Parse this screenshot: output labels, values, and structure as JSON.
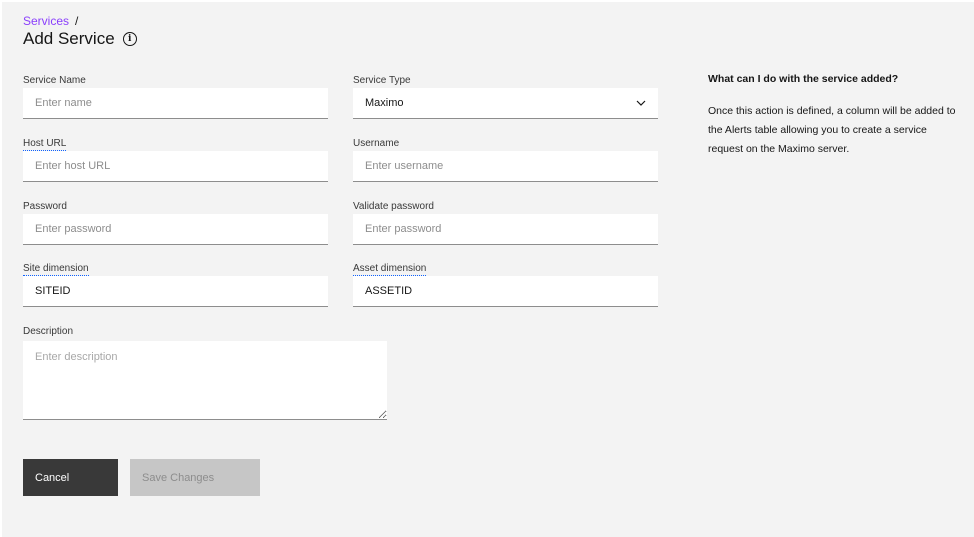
{
  "breadcrumb": {
    "parent": "Services",
    "separator": "/"
  },
  "page": {
    "title": "Add Service",
    "info_icon": "info-icon"
  },
  "form": {
    "service_name": {
      "label": "Service Name",
      "placeholder": "Enter name",
      "value": ""
    },
    "service_type": {
      "label": "Service Type",
      "value": "Maximo"
    },
    "host_url": {
      "label": "Host URL",
      "placeholder": "Enter host URL",
      "value": ""
    },
    "username": {
      "label": "Username",
      "placeholder": "Enter username",
      "value": ""
    },
    "password": {
      "label": "Password",
      "placeholder": "Enter password",
      "value": ""
    },
    "validate_password": {
      "label": "Validate password",
      "placeholder": "Enter password",
      "value": ""
    },
    "site_dimension": {
      "label": "Site dimension",
      "value": "SITEID"
    },
    "asset_dimension": {
      "label": "Asset dimension",
      "value": "ASSETID"
    },
    "description": {
      "label": "Description",
      "placeholder": "Enter description",
      "value": ""
    }
  },
  "buttons": {
    "cancel": "Cancel",
    "save": "Save Changes"
  },
  "help": {
    "title": "What can I do with the service added?",
    "body": "Once this action is defined, a column will be added to the Alerts table allowing you to create a service request on the Maximo server."
  },
  "colors": {
    "accent_link": "#8a3ffc",
    "primary_button": "#393939",
    "disabled_button": "#c6c6c6",
    "background": "#f3f3f3"
  }
}
